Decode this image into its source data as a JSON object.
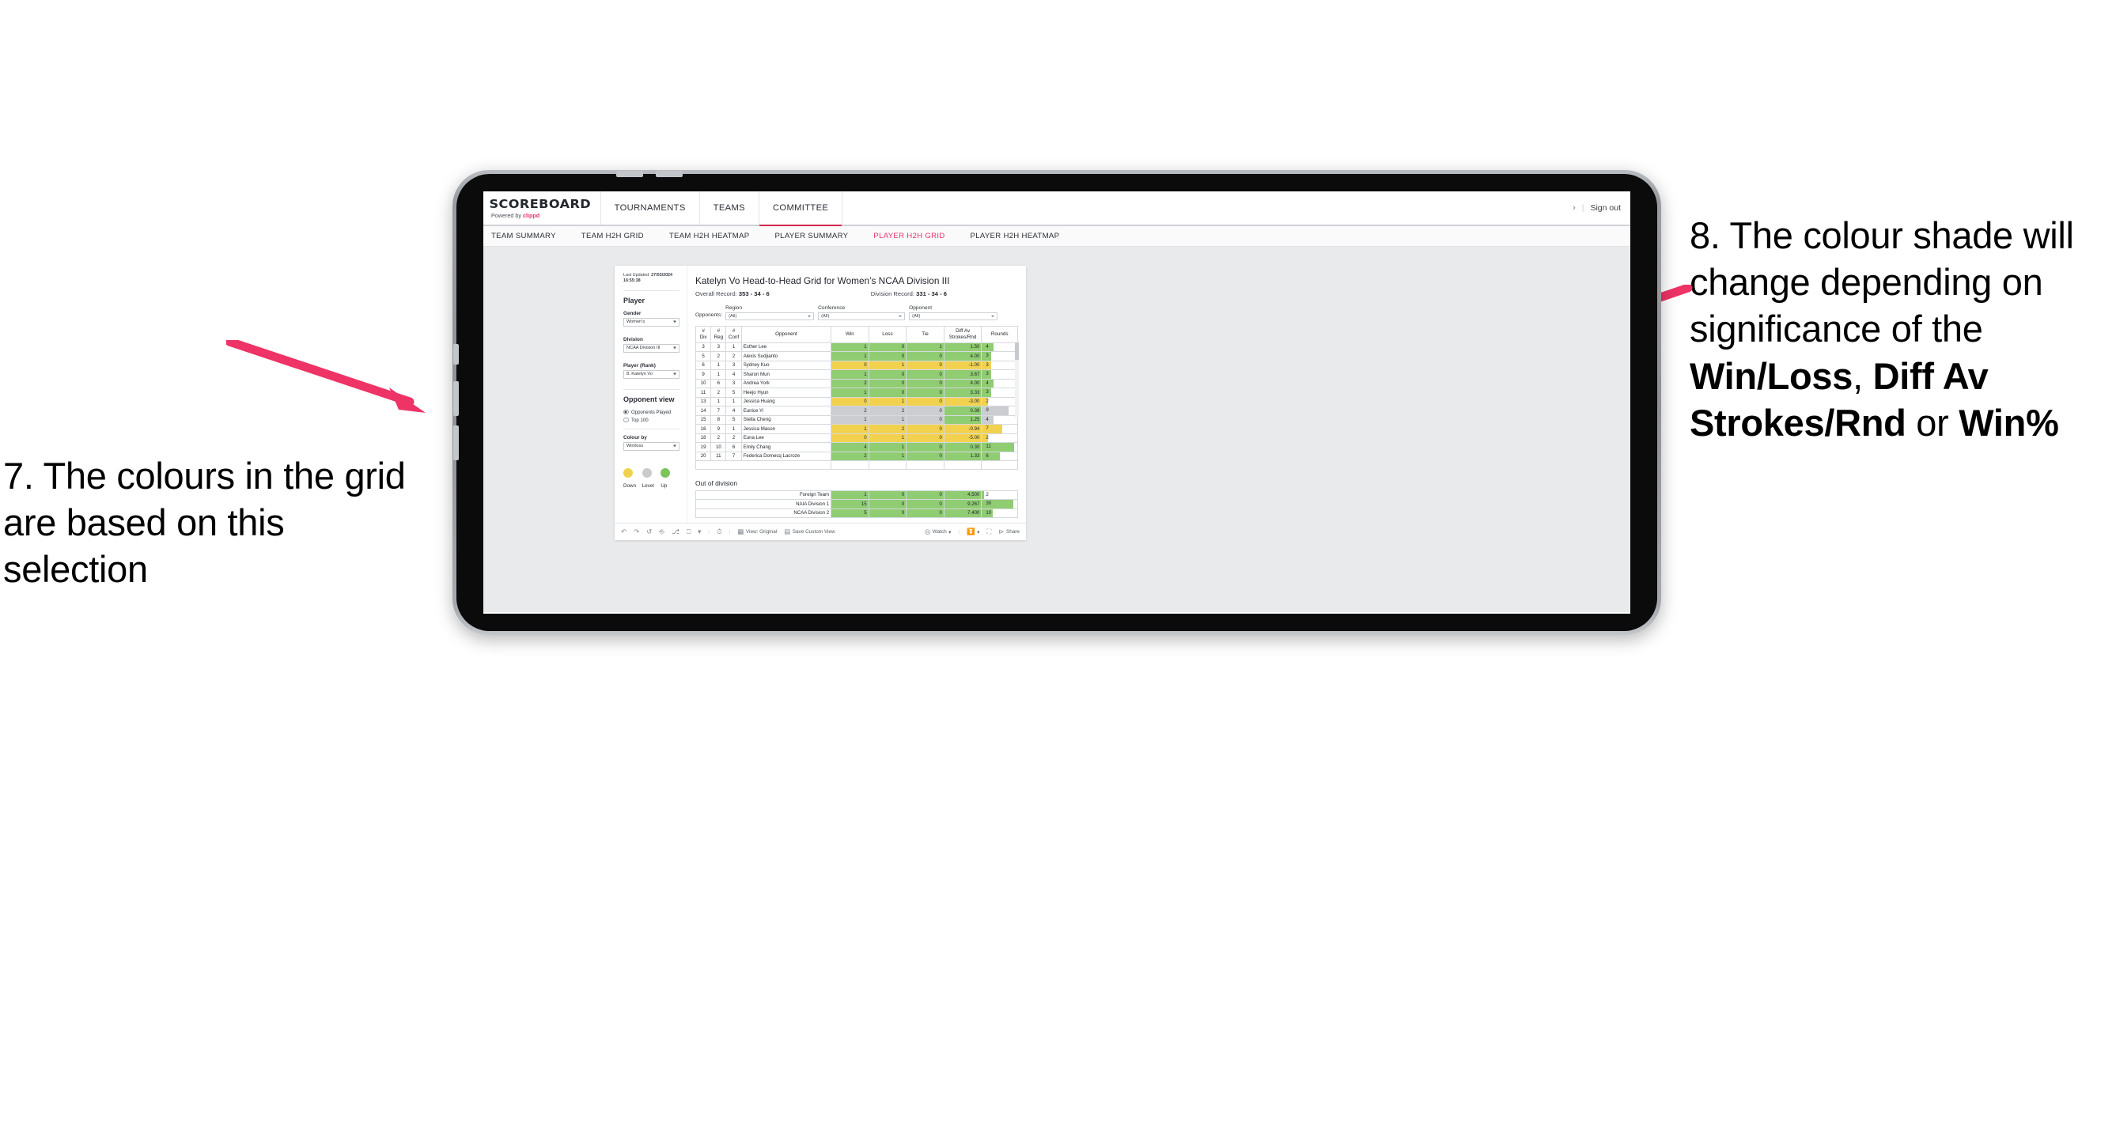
{
  "annotations": {
    "left": {
      "id": "7.",
      "text": "7. The colours in the grid are based on this selection"
    },
    "right": {
      "id": "8.",
      "lead": "8. The colour shade will change depending on significance of the ",
      "bold1": "Win/Loss",
      "mid1": ", ",
      "bold2": "Diff Av Strokes/Rnd",
      "mid2": " or ",
      "bold3": "Win%"
    },
    "arrow_color": "#ee3366"
  },
  "header": {
    "logo_main": "SCOREBOARD",
    "logo_sub_prefix": "Powered by ",
    "logo_brand": "clippd",
    "nav": [
      {
        "label": "TOURNAMENTS",
        "active": false
      },
      {
        "label": "TEAMS",
        "active": false
      },
      {
        "label": "COMMITTEE",
        "active": true
      }
    ],
    "chevron": "›",
    "divider": "|",
    "sign_out": "Sign out"
  },
  "subnav": [
    {
      "label": "TEAM SUMMARY",
      "active": false
    },
    {
      "label": "TEAM H2H GRID",
      "active": false
    },
    {
      "label": "TEAM H2H HEATMAP",
      "active": false
    },
    {
      "label": "PLAYER SUMMARY",
      "active": false
    },
    {
      "label": "PLAYER H2H GRID",
      "active": true
    },
    {
      "label": "PLAYER H2H HEATMAP",
      "active": false
    }
  ],
  "sidebar": {
    "last_updated_label": "Last Updated: ",
    "last_updated_date": "27/03/2024",
    "last_updated_time": "16:55:38",
    "section_player": "Player",
    "gender_label": "Gender",
    "gender_value": "Women’s",
    "division_label": "Division",
    "division_value": "NCAA Division III",
    "player_rank_label": "Player (Rank)",
    "player_rank_value": "8. Katelyn Vo",
    "opponent_view_label": "Opponent view",
    "opponent_view_options": [
      {
        "label": "Opponents Played",
        "selected": true
      },
      {
        "label": "Top 100",
        "selected": false
      }
    ],
    "colour_by_label": "Colour by",
    "colour_by_value": "Win/loss",
    "legend": [
      {
        "label": "Down",
        "color": "#f0d14e"
      },
      {
        "label": "Level",
        "color": "#c8cacd"
      },
      {
        "label": "Up",
        "color": "#7dc35c"
      }
    ]
  },
  "main": {
    "title": "Katelyn Vo Head-to-Head Grid for Women’s NCAA Division III",
    "overall_record_label": "Overall Record: ",
    "overall_record_value": "353 -  34 - 6",
    "division_record_label": "Division Record: ",
    "division_record_value": "331 -  34 - 6",
    "opponents_label": "Opponents:",
    "filters": [
      {
        "label": "Region",
        "value": "(All)"
      },
      {
        "label": "Conference",
        "value": "(All)"
      },
      {
        "label": "Opponent",
        "value": "(All)"
      }
    ],
    "columns": [
      {
        "line1": "#",
        "line2": "Div"
      },
      {
        "line1": "#",
        "line2": "Reg"
      },
      {
        "line1": "#",
        "line2": "Conf"
      },
      {
        "line1": "Opponent",
        "line2": ""
      },
      {
        "line1": "Win",
        "line2": ""
      },
      {
        "line1": "Loss",
        "line2": ""
      },
      {
        "line1": "Tie",
        "line2": ""
      },
      {
        "line1": "Diff Av",
        "line2": "Strokes/Rnd"
      },
      {
        "line1": "Rounds",
        "line2": ""
      }
    ],
    "out_of_division_title": "Out of division"
  },
  "chart_data": {
    "type": "table",
    "title": "Katelyn Vo Head-to-Head Grid for Women’s NCAA Division III",
    "columns": [
      "# Div",
      "# Reg",
      "# Conf",
      "Opponent",
      "Win",
      "Loss",
      "Tie",
      "Diff Av Strokes/Rnd",
      "Rounds"
    ],
    "colour_by": "Win/loss",
    "colour_scale": {
      "up": "#8fcc72",
      "level": "#cbcdd0",
      "down": "#f2d14f"
    },
    "rounds_max": 12,
    "rows": [
      {
        "div": "3",
        "reg": "3",
        "conf": "1",
        "opponent": "Esther Lee",
        "win": "1",
        "loss": "0",
        "tie": "1",
        "diff": "1.50",
        "rounds": "4",
        "state": "up"
      },
      {
        "div": "5",
        "reg": "2",
        "conf": "2",
        "opponent": "Alexis Sudjianto",
        "win": "1",
        "loss": "0",
        "tie": "0",
        "diff": "4.00",
        "rounds": "3",
        "state": "up"
      },
      {
        "div": "6",
        "reg": "1",
        "conf": "3",
        "opponent": "Sydney Kuo",
        "win": "0",
        "loss": "1",
        "tie": "0",
        "diff": "-1.00",
        "rounds": "3",
        "state": "down"
      },
      {
        "div": "9",
        "reg": "1",
        "conf": "4",
        "opponent": "Sharon Mun",
        "win": "1",
        "loss": "0",
        "tie": "0",
        "diff": "3.67",
        "rounds": "3",
        "state": "up"
      },
      {
        "div": "10",
        "reg": "6",
        "conf": "3",
        "opponent": "Andrea York",
        "win": "2",
        "loss": "0",
        "tie": "0",
        "diff": "4.00",
        "rounds": "4",
        "state": "up"
      },
      {
        "div": "11",
        "reg": "2",
        "conf": "5",
        "opponent": "Heejo Hyun",
        "win": "1",
        "loss": "0",
        "tie": "0",
        "diff": "3.33",
        "rounds": "3",
        "state": "up"
      },
      {
        "div": "13",
        "reg": "1",
        "conf": "1",
        "opponent": "Jessica Huang",
        "win": "0",
        "loss": "1",
        "tie": "0",
        "diff": "-3.00",
        "rounds": "2",
        "state": "down"
      },
      {
        "div": "14",
        "reg": "7",
        "conf": "4",
        "opponent": "Eunice Yi",
        "win": "2",
        "loss": "2",
        "tie": "0",
        "diff": "0.38",
        "rounds": "9",
        "state": "level"
      },
      {
        "div": "15",
        "reg": "8",
        "conf": "5",
        "opponent": "Stella Cheng",
        "win": "1",
        "loss": "1",
        "tie": "0",
        "diff": "1.25",
        "rounds": "4",
        "state": "level"
      },
      {
        "div": "16",
        "reg": "9",
        "conf": "1",
        "opponent": "Jessica Mason",
        "win": "1",
        "loss": "2",
        "tie": "0",
        "diff": "-0.94",
        "rounds": "7",
        "state": "down"
      },
      {
        "div": "18",
        "reg": "2",
        "conf": "2",
        "opponent": "Euna Lee",
        "win": "0",
        "loss": "1",
        "tie": "0",
        "diff": "-5.00",
        "rounds": "2",
        "state": "down"
      },
      {
        "div": "19",
        "reg": "10",
        "conf": "6",
        "opponent": "Emily Chang",
        "win": "4",
        "loss": "1",
        "tie": "0",
        "diff": "0.30",
        "rounds": "11",
        "state": "up"
      },
      {
        "div": "20",
        "reg": "11",
        "conf": "7",
        "opponent": "Federica Domecq Lacroze",
        "win": "2",
        "loss": "1",
        "tie": "0",
        "diff": "1.33",
        "rounds": "6",
        "state": "up"
      }
    ],
    "out_of_division": [
      {
        "name": "Foreign Team",
        "win": "1",
        "loss": "0",
        "tie": "0",
        "diff": "4.500",
        "rounds": "2",
        "state": "up"
      },
      {
        "name": "NAIA Division 1",
        "win": "15",
        "loss": "0",
        "tie": "0",
        "diff": "9.267",
        "rounds": "30",
        "state": "up"
      },
      {
        "name": "NCAA Division 2",
        "win": "5",
        "loss": "0",
        "tie": "0",
        "diff": "7.400",
        "rounds": "10",
        "state": "up"
      }
    ],
    "out_of_division_rounds_max": 34
  },
  "toolbar": {
    "view_label": "View: Original",
    "save_label": "Save Custom View",
    "watch_label": "Watch",
    "share_label": "Share",
    "caret": "▾"
  }
}
